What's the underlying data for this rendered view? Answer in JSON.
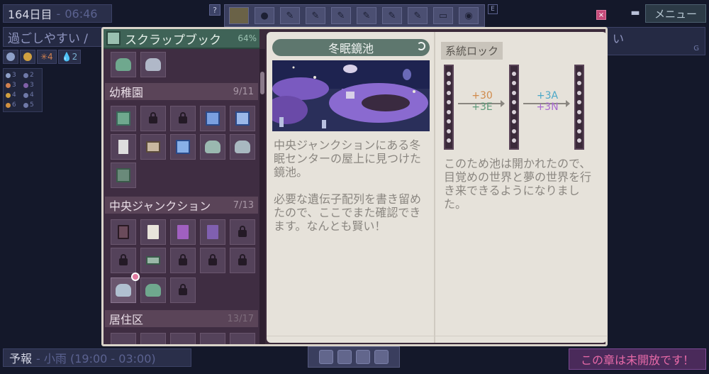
{
  "hud": {
    "day": "164日目",
    "sep": "-",
    "time": "06:46",
    "mood": "過ごしやすい /",
    "stats": [
      {
        "icon": "gear-icon",
        "value": "",
        "color": "#8ea0c8"
      },
      {
        "icon": "sun-icon",
        "value": "",
        "color": "#d0a040"
      },
      {
        "icon": "snow-icon",
        "value": "✳4",
        "color": "#d08050"
      },
      {
        "icon": "water-icon",
        "value": "💧2",
        "color": "#7ab0d0"
      }
    ],
    "mini_stats": [
      {
        "color": "#8ea0c8",
        "value": "3"
      },
      {
        "color": "#6f79a8",
        "value": "2"
      },
      {
        "color": "#d08050",
        "value": "3"
      },
      {
        "color": "#8060a8",
        "value": "3"
      },
      {
        "color": "#d0a040",
        "value": "4"
      },
      {
        "color": "#6f79a8",
        "value": "4"
      },
      {
        "color": "#d09040",
        "value": "6"
      },
      {
        "color": "#6f79a8",
        "value": "5"
      }
    ],
    "help_label": "?",
    "e_key": "E",
    "close_label": "×",
    "menu_label": "メニュー",
    "save_icon": "▬",
    "right_banner": "い",
    "right_banner_key": "G",
    "forecast_label": "予報",
    "forecast_detail": "- 小雨 (19:00 - 03:00)",
    "chapter_lock": "この章は未開放です！"
  },
  "scrapbook": {
    "title": "スクラップブック",
    "percent": "64%",
    "categories": [
      {
        "name": "幼稚園",
        "count": "9/11"
      },
      {
        "name": "中央ジャンクション",
        "count": "7/13"
      },
      {
        "name": "居住区",
        "count": "13/17"
      }
    ]
  },
  "entry": {
    "title": "冬眠鏡池",
    "description": "中央ジャンクションにある冬眠センターの屋上に見つけた鏡池。\n\n必要な遺伝子配列を書き留めたので、ここでまた確認できます。なんとも賢い！",
    "lock_label": "系統ロック",
    "gene_a1": "+30",
    "gene_a2": "+3E",
    "gene_b1": "+3A",
    "gene_b2": "+3N",
    "lock_description": "このため池は開かれたので、目覚めの世界と夢の世界を行き来できるようになりました。"
  },
  "colors": {
    "gene_orange": "#d08a4a",
    "gene_green": "#5e9a7a",
    "gene_blue": "#4aa8c8",
    "gene_purple": "#a86ad0"
  }
}
